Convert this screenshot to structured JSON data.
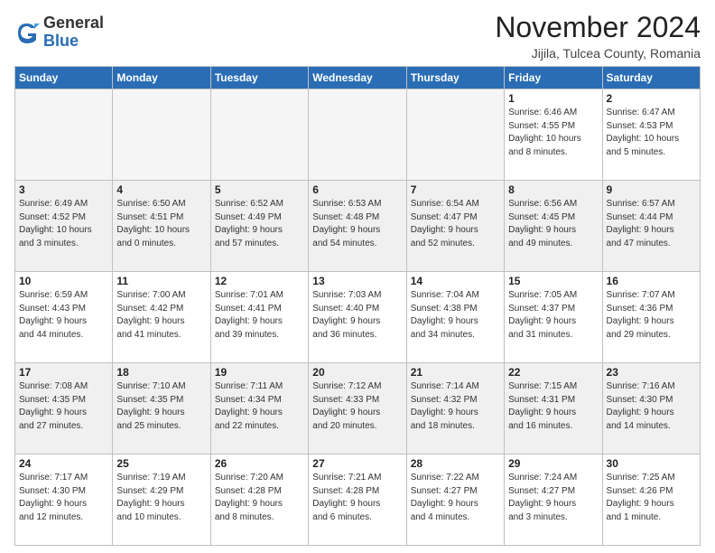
{
  "logo": {
    "general": "General",
    "blue": "Blue"
  },
  "title": "November 2024",
  "location": "Jijila, Tulcea County, Romania",
  "weekdays": [
    "Sunday",
    "Monday",
    "Tuesday",
    "Wednesday",
    "Thursday",
    "Friday",
    "Saturday"
  ],
  "weeks": [
    [
      {
        "day": "",
        "info": ""
      },
      {
        "day": "",
        "info": ""
      },
      {
        "day": "",
        "info": ""
      },
      {
        "day": "",
        "info": ""
      },
      {
        "day": "",
        "info": ""
      },
      {
        "day": "1",
        "info": "Sunrise: 6:46 AM\nSunset: 4:55 PM\nDaylight: 10 hours\nand 8 minutes."
      },
      {
        "day": "2",
        "info": "Sunrise: 6:47 AM\nSunset: 4:53 PM\nDaylight: 10 hours\nand 5 minutes."
      }
    ],
    [
      {
        "day": "3",
        "info": "Sunrise: 6:49 AM\nSunset: 4:52 PM\nDaylight: 10 hours\nand 3 minutes."
      },
      {
        "day": "4",
        "info": "Sunrise: 6:50 AM\nSunset: 4:51 PM\nDaylight: 10 hours\nand 0 minutes."
      },
      {
        "day": "5",
        "info": "Sunrise: 6:52 AM\nSunset: 4:49 PM\nDaylight: 9 hours\nand 57 minutes."
      },
      {
        "day": "6",
        "info": "Sunrise: 6:53 AM\nSunset: 4:48 PM\nDaylight: 9 hours\nand 54 minutes."
      },
      {
        "day": "7",
        "info": "Sunrise: 6:54 AM\nSunset: 4:47 PM\nDaylight: 9 hours\nand 52 minutes."
      },
      {
        "day": "8",
        "info": "Sunrise: 6:56 AM\nSunset: 4:45 PM\nDaylight: 9 hours\nand 49 minutes."
      },
      {
        "day": "9",
        "info": "Sunrise: 6:57 AM\nSunset: 4:44 PM\nDaylight: 9 hours\nand 47 minutes."
      }
    ],
    [
      {
        "day": "10",
        "info": "Sunrise: 6:59 AM\nSunset: 4:43 PM\nDaylight: 9 hours\nand 44 minutes."
      },
      {
        "day": "11",
        "info": "Sunrise: 7:00 AM\nSunset: 4:42 PM\nDaylight: 9 hours\nand 41 minutes."
      },
      {
        "day": "12",
        "info": "Sunrise: 7:01 AM\nSunset: 4:41 PM\nDaylight: 9 hours\nand 39 minutes."
      },
      {
        "day": "13",
        "info": "Sunrise: 7:03 AM\nSunset: 4:40 PM\nDaylight: 9 hours\nand 36 minutes."
      },
      {
        "day": "14",
        "info": "Sunrise: 7:04 AM\nSunset: 4:38 PM\nDaylight: 9 hours\nand 34 minutes."
      },
      {
        "day": "15",
        "info": "Sunrise: 7:05 AM\nSunset: 4:37 PM\nDaylight: 9 hours\nand 31 minutes."
      },
      {
        "day": "16",
        "info": "Sunrise: 7:07 AM\nSunset: 4:36 PM\nDaylight: 9 hours\nand 29 minutes."
      }
    ],
    [
      {
        "day": "17",
        "info": "Sunrise: 7:08 AM\nSunset: 4:35 PM\nDaylight: 9 hours\nand 27 minutes."
      },
      {
        "day": "18",
        "info": "Sunrise: 7:10 AM\nSunset: 4:35 PM\nDaylight: 9 hours\nand 25 minutes."
      },
      {
        "day": "19",
        "info": "Sunrise: 7:11 AM\nSunset: 4:34 PM\nDaylight: 9 hours\nand 22 minutes."
      },
      {
        "day": "20",
        "info": "Sunrise: 7:12 AM\nSunset: 4:33 PM\nDaylight: 9 hours\nand 20 minutes."
      },
      {
        "day": "21",
        "info": "Sunrise: 7:14 AM\nSunset: 4:32 PM\nDaylight: 9 hours\nand 18 minutes."
      },
      {
        "day": "22",
        "info": "Sunrise: 7:15 AM\nSunset: 4:31 PM\nDaylight: 9 hours\nand 16 minutes."
      },
      {
        "day": "23",
        "info": "Sunrise: 7:16 AM\nSunset: 4:30 PM\nDaylight: 9 hours\nand 14 minutes."
      }
    ],
    [
      {
        "day": "24",
        "info": "Sunrise: 7:17 AM\nSunset: 4:30 PM\nDaylight: 9 hours\nand 12 minutes."
      },
      {
        "day": "25",
        "info": "Sunrise: 7:19 AM\nSunset: 4:29 PM\nDaylight: 9 hours\nand 10 minutes."
      },
      {
        "day": "26",
        "info": "Sunrise: 7:20 AM\nSunset: 4:28 PM\nDaylight: 9 hours\nand 8 minutes."
      },
      {
        "day": "27",
        "info": "Sunrise: 7:21 AM\nSunset: 4:28 PM\nDaylight: 9 hours\nand 6 minutes."
      },
      {
        "day": "28",
        "info": "Sunrise: 7:22 AM\nSunset: 4:27 PM\nDaylight: 9 hours\nand 4 minutes."
      },
      {
        "day": "29",
        "info": "Sunrise: 7:24 AM\nSunset: 4:27 PM\nDaylight: 9 hours\nand 3 minutes."
      },
      {
        "day": "30",
        "info": "Sunrise: 7:25 AM\nSunset: 4:26 PM\nDaylight: 9 hours\nand 1 minute."
      }
    ]
  ]
}
